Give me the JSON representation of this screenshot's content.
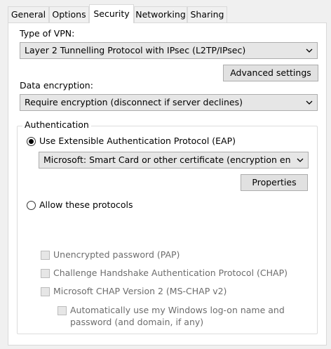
{
  "tabs": [
    {
      "label": "General"
    },
    {
      "label": "Options"
    },
    {
      "label": "Security",
      "active": true
    },
    {
      "label": "Networking"
    },
    {
      "label": "Sharing"
    }
  ],
  "vpn": {
    "type_label": "Type of VPN:",
    "type_value": "Layer 2 Tunnelling Protocol with IPsec (L2TP/IPsec)",
    "advanced_button": "Advanced settings"
  },
  "encryption": {
    "label": "Data encryption:",
    "value": "Require encryption (disconnect if server declines)"
  },
  "authentication": {
    "legend": "Authentication",
    "eap_radio_label": "Use Extensible Authentication Protocol (EAP)",
    "eap_selected": true,
    "eap_method": "Microsoft: Smart Card or other certificate (encryption enabled)",
    "properties_button": "Properties",
    "allow_radio_label": "Allow these protocols",
    "allow_selected": false,
    "protocols": {
      "pap": "Unencrypted password (PAP)",
      "chap": "Challenge Handshake Authentication Protocol (CHAP)",
      "mschapv2": "Microsoft CHAP Version 2 (MS-CHAP v2)",
      "auto_logon_line1": "Automatically use my Windows log-on name and",
      "auto_logon_line2": "password (and domain, if any)"
    }
  },
  "colors": {
    "panel_bg": "#ffffff",
    "window_bg": "#f0f0f0",
    "disabled_text": "#6d6d6d"
  }
}
